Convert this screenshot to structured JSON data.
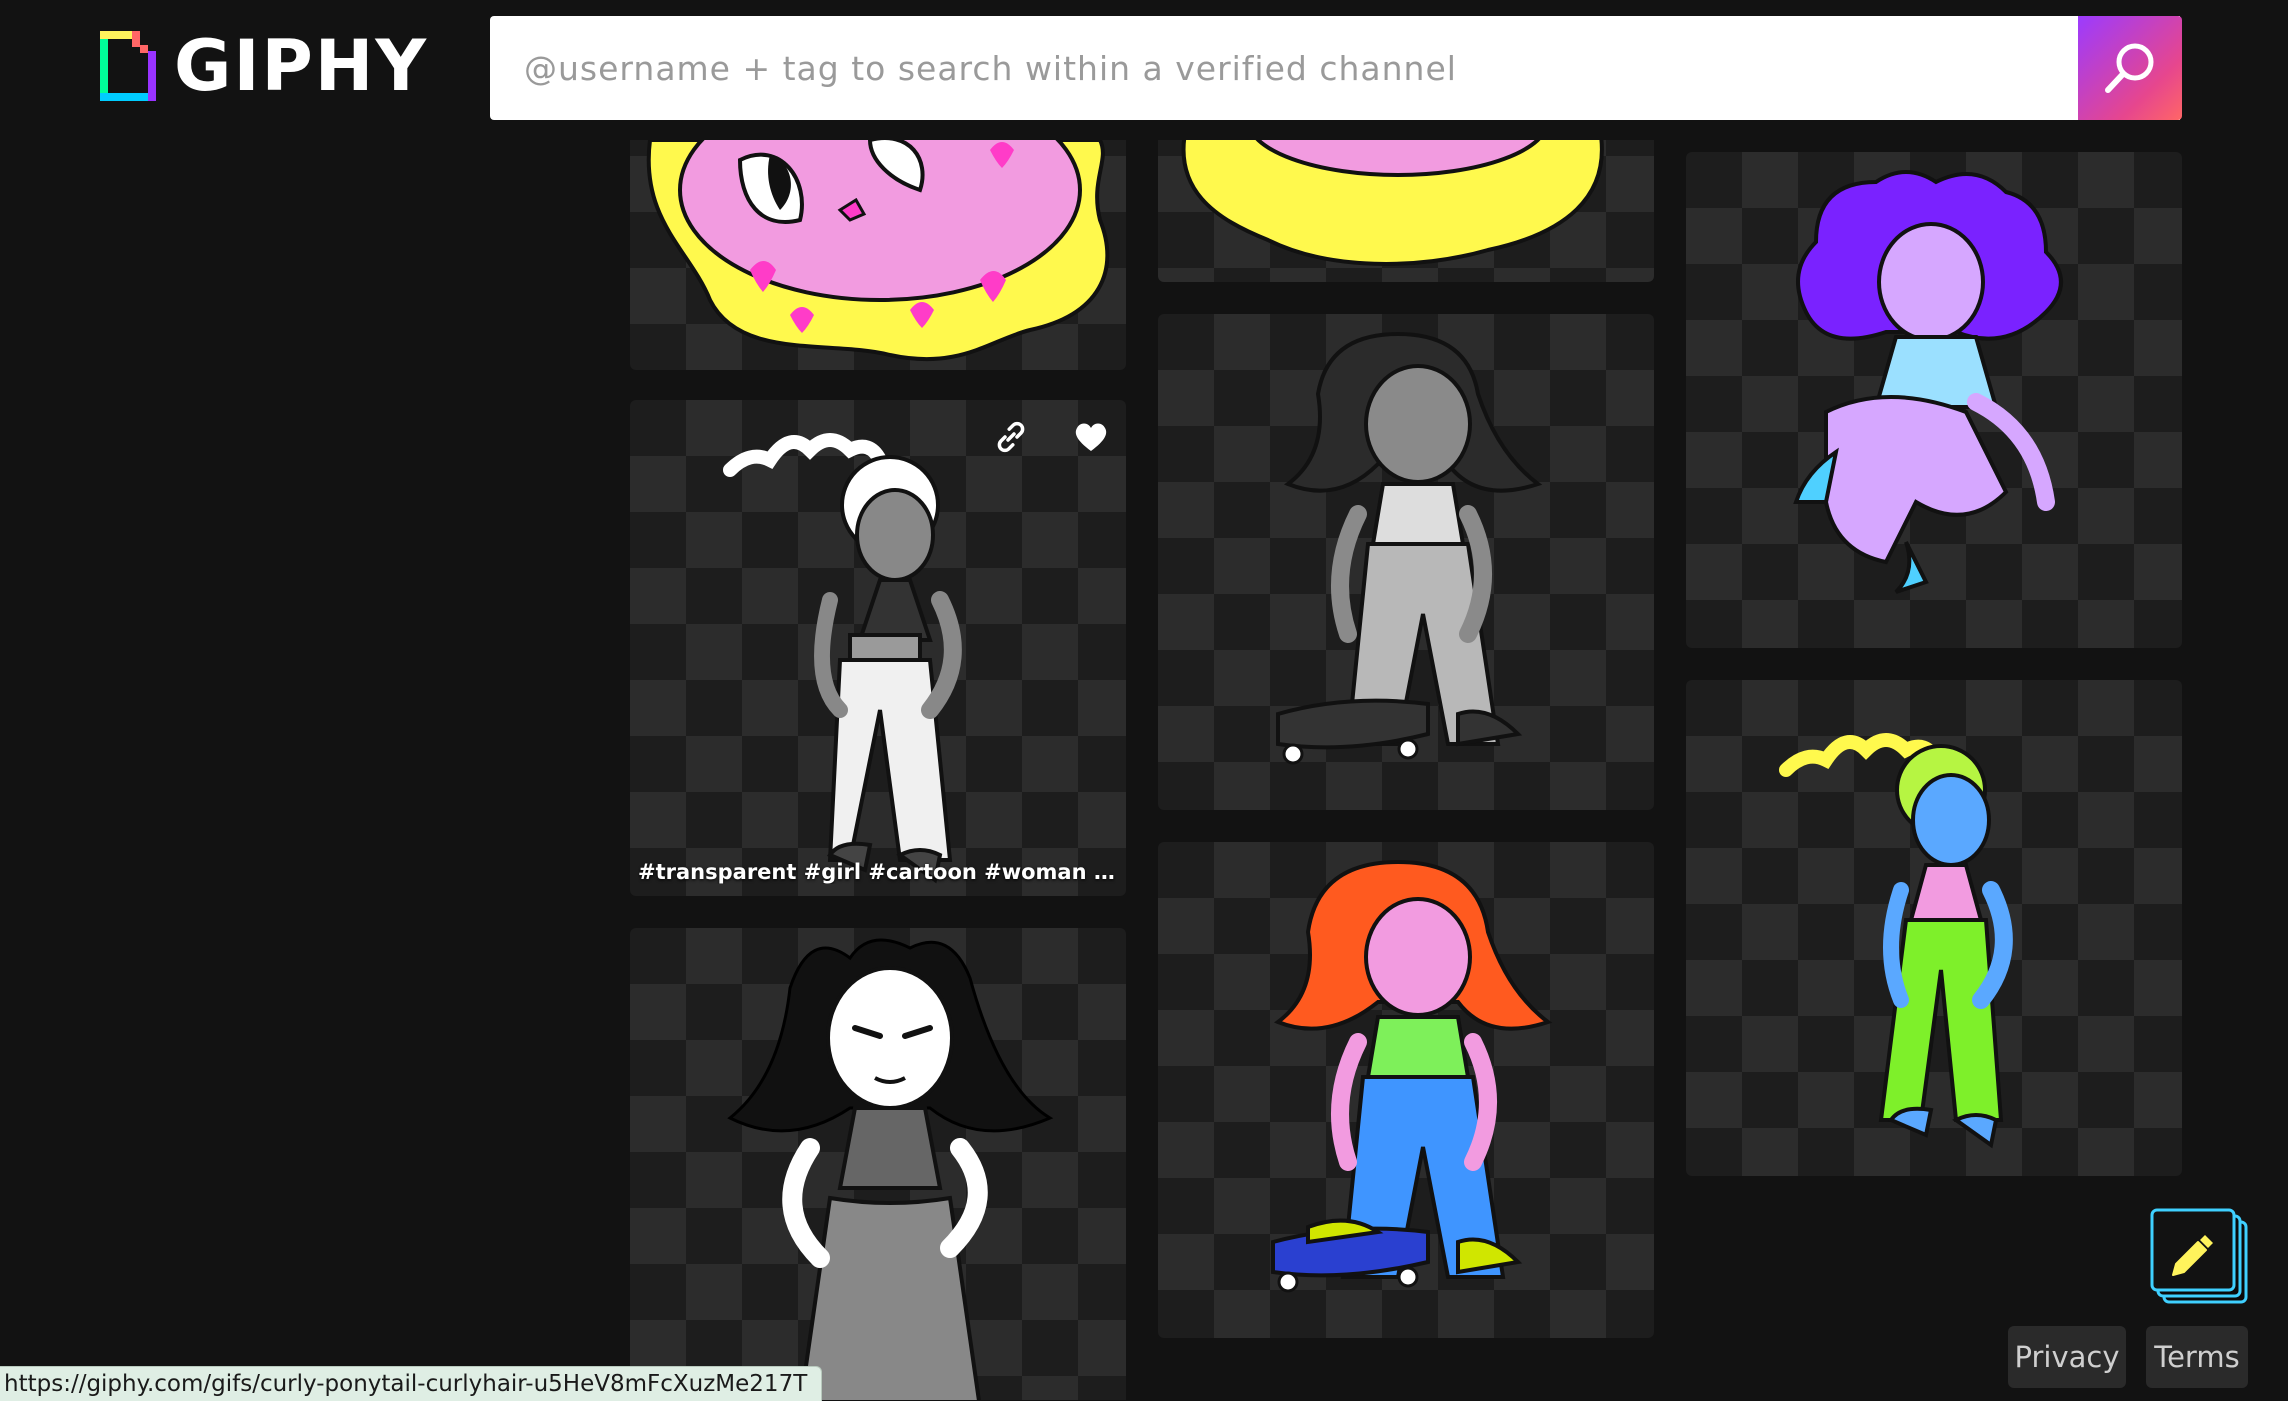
{
  "header": {
    "logo_text": "GIPHY",
    "search_placeholder": "@username + tag to search within a verified channel",
    "search_icon": "search-icon"
  },
  "gif_tiles": [
    {
      "name": "gif-pink-face-hearts",
      "col": 1,
      "has_overlay": false
    },
    {
      "name": "gif-grayscale-curly-ponytail-girl",
      "col": 1,
      "has_overlay": true,
      "tags": "#transparent #girl #cartoon #woman #nic..."
    },
    {
      "name": "gif-black-hair-girl",
      "col": 1,
      "has_overlay": false
    },
    {
      "name": "gif-yellow-flower-face",
      "col": 2,
      "has_overlay": false
    },
    {
      "name": "gif-grayscale-skateboard-girl",
      "col": 2,
      "has_overlay": false
    },
    {
      "name": "gif-redhead-skateboard-girl",
      "col": 2,
      "has_overlay": false
    },
    {
      "name": "gif-purple-hair-sitting-girl",
      "col": 3,
      "has_overlay": false
    },
    {
      "name": "gif-blue-ponytail-girl",
      "col": 3,
      "has_overlay": false
    }
  ],
  "overlay_icons": {
    "copy_link": "link-icon",
    "favorite": "heart-icon"
  },
  "footer": {
    "privacy_label": "Privacy",
    "terms_label": "Terms",
    "edit_icon": "pencil-icon"
  },
  "status_bar": {
    "url": "https://giphy.com/gifs/curly-ponytail-curlyhair-u5HeV8mFcXuzMe217T"
  },
  "colors": {
    "background": "#121212",
    "search_gradient_start": "#9b3bff",
    "search_gradient_end": "#ff6666",
    "fab_accent": "#3fd0ff"
  }
}
